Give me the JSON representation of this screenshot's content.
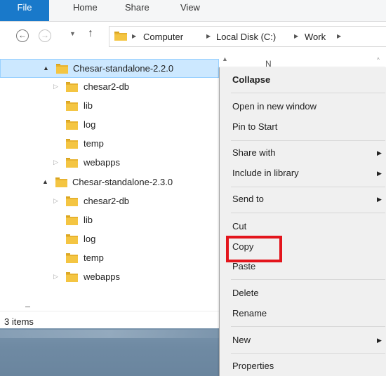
{
  "ribbon": {
    "tabs": [
      "File",
      "Home",
      "Share",
      "View"
    ]
  },
  "navigation": {
    "back_icon": "back-arrow-icon",
    "forward_icon": "forward-arrow-icon",
    "recent_icon": "chevron-down-icon",
    "up_icon": "up-arrow-icon",
    "breadcrumb": [
      "Computer",
      "Local Disk (C:)",
      "Work"
    ]
  },
  "tree": [
    {
      "label": "Chesar-standalone-2.2.0",
      "expander": "▲",
      "selected": true
    },
    {
      "label": "chesar2-db",
      "expander": "▷"
    },
    {
      "label": "lib",
      "expander": ""
    },
    {
      "label": "log",
      "expander": ""
    },
    {
      "label": "temp",
      "expander": ""
    },
    {
      "label": "webapps",
      "expander": "▷"
    },
    {
      "label": "Chesar-standalone-2.3.0",
      "expander": "▲"
    },
    {
      "label": "chesar2-db",
      "expander": "▷"
    },
    {
      "label": "lib",
      "expander": ""
    },
    {
      "label": "log",
      "expander": ""
    },
    {
      "label": "temp",
      "expander": ""
    },
    {
      "label": "webapps",
      "expander": "▷"
    }
  ],
  "right_pane": {
    "column_fragment": "N",
    "sort_caret": "^"
  },
  "status": {
    "items": "3 items"
  },
  "context_menu": {
    "collapse": "Collapse",
    "open_new_window": "Open in new window",
    "pin_to_start": "Pin to Start",
    "share_with": "Share with",
    "include_in_library": "Include in library",
    "send_to": "Send to",
    "cut": "Cut",
    "copy": "Copy",
    "paste": "Paste",
    "delete": "Delete",
    "rename": "Rename",
    "new": "New",
    "properties": "Properties",
    "submenu_arrow": "▶"
  },
  "colors": {
    "file_tab": "#1979ca",
    "selection": "#cce8ff",
    "highlight_box": "#e3151c",
    "folder": "#f4c542"
  }
}
